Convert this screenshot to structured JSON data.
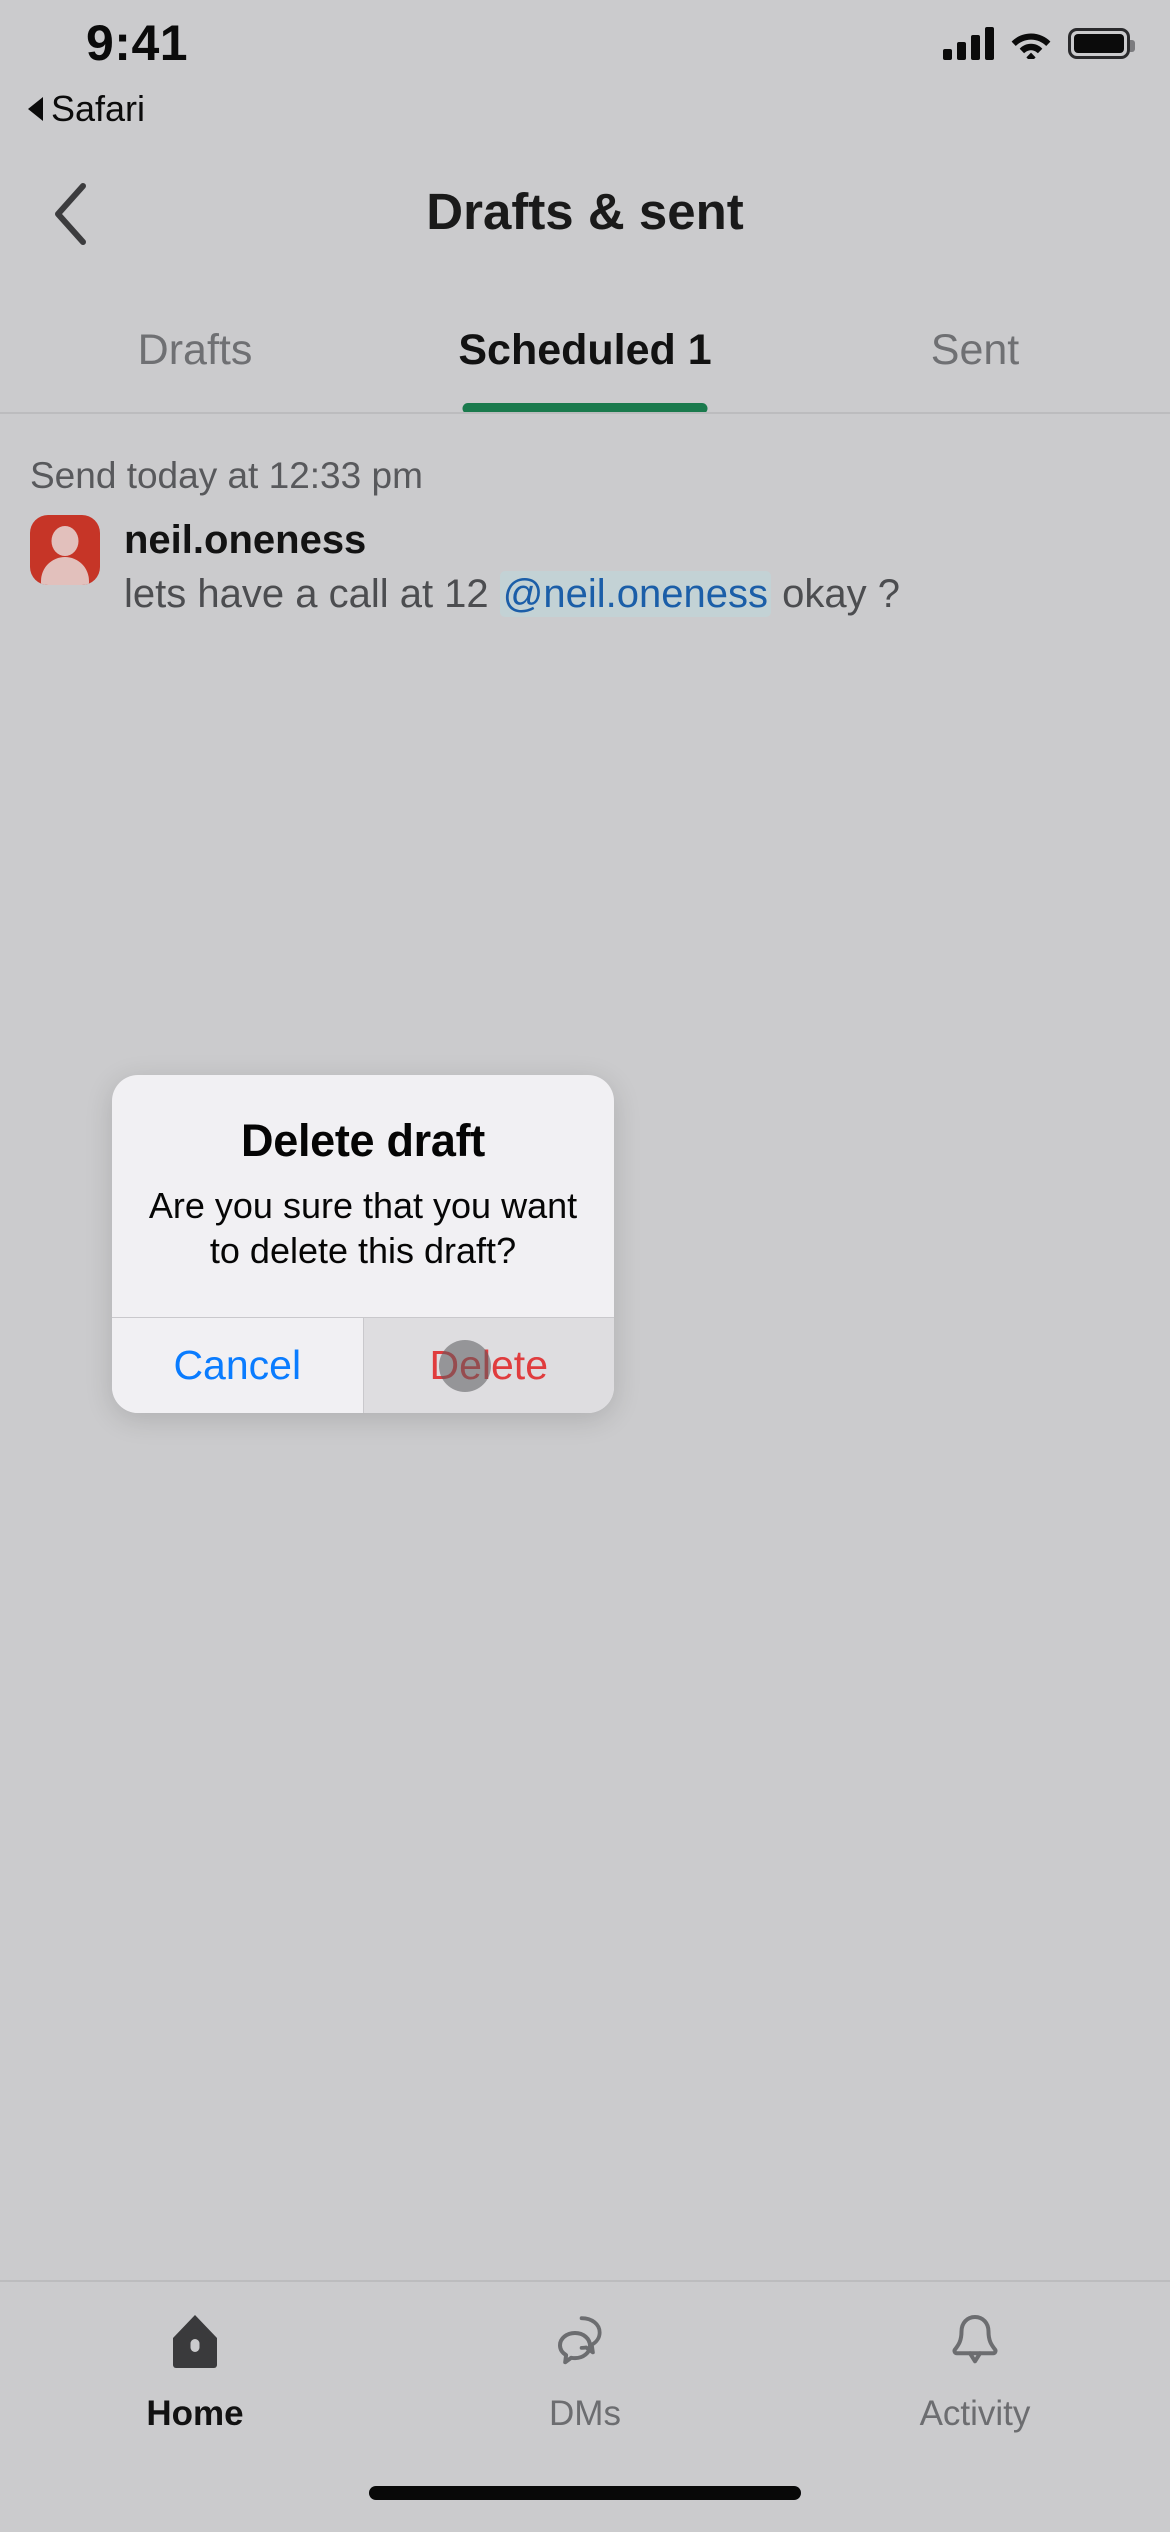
{
  "status_bar": {
    "time": "9:41",
    "back_app_label": "Safari",
    "icons": [
      "cellular-signal-icon",
      "wifi-icon",
      "battery-icon"
    ]
  },
  "nav": {
    "back_icon": "chevron-left-icon",
    "title": "Drafts & sent"
  },
  "tabs": {
    "items": [
      {
        "label": "Drafts",
        "active": false
      },
      {
        "label": "Scheduled 1",
        "active": true
      },
      {
        "label": "Sent",
        "active": false
      }
    ],
    "active_indicator_color": "#1a7a4d"
  },
  "draft": {
    "send_time": "Send today at 12:33 pm",
    "avatar_color": "#c63527",
    "username": "neil.oneness",
    "text_before_mention": "lets have a call at 12 ",
    "mention": "@neil.oneness",
    "text_after_mention": "okay ?",
    "mention_color": "#1b5ea8",
    "mention_bg": "#c3d2d5"
  },
  "alert": {
    "title": "Delete draft",
    "message": "Are you sure that you want to delete this draft?",
    "cancel_label": "Cancel",
    "cancel_color": "#0a7cff",
    "delete_label": "Delete",
    "delete_color": "#e03c3e"
  },
  "tabbar": {
    "items": [
      {
        "label": "Home",
        "icon": "home-icon",
        "active": true
      },
      {
        "label": "DMs",
        "icon": "chat-bubbles-icon",
        "active": false
      },
      {
        "label": "Activity",
        "icon": "bell-icon",
        "active": false
      }
    ]
  }
}
